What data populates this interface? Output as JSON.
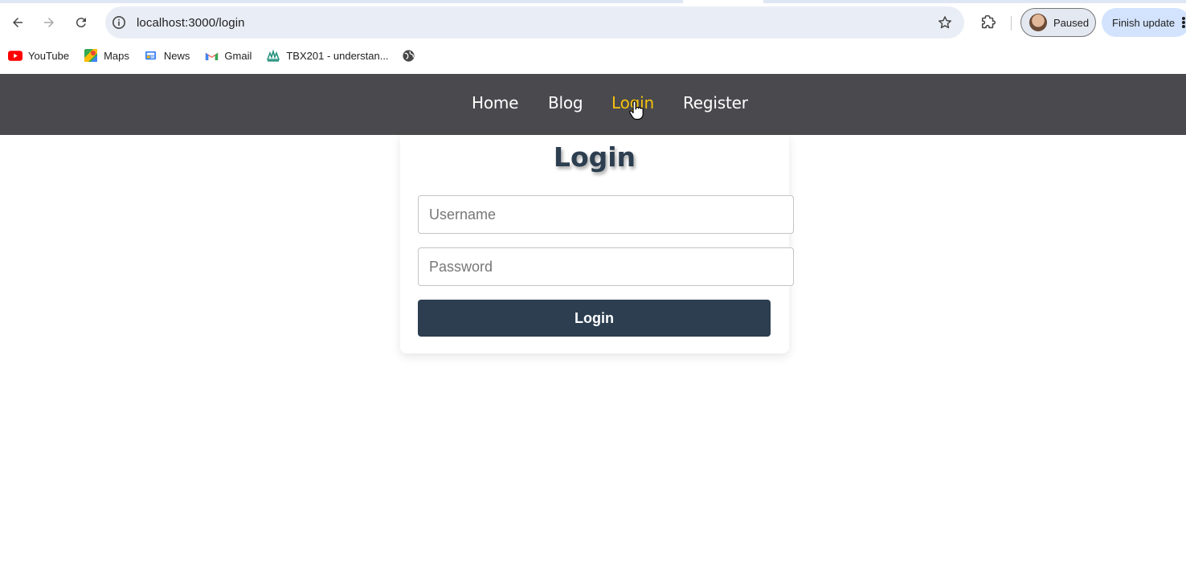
{
  "browser": {
    "url": "localhost:3000/login",
    "profile_label": "Paused",
    "update_label": "Finish update"
  },
  "bookmarks": [
    {
      "label": "YouTube",
      "icon": "youtube-icon"
    },
    {
      "label": "Maps",
      "icon": "maps-icon"
    },
    {
      "label": "News",
      "icon": "news-icon"
    },
    {
      "label": "Gmail",
      "icon": "gmail-icon"
    },
    {
      "label": "TBX201 - understan...",
      "icon": "tbx-icon"
    },
    {
      "label": "",
      "icon": "globe-icon"
    }
  ],
  "site_nav": {
    "items": [
      {
        "label": "Home"
      },
      {
        "label": "Blog"
      },
      {
        "label": "Login",
        "active": true
      },
      {
        "label": "Register"
      }
    ],
    "active_color": "#f4c20d",
    "background": "#4a494d"
  },
  "login_form": {
    "title": "Login",
    "username_placeholder": "Username",
    "password_placeholder": "Password",
    "submit_label": "Login",
    "button_color": "#2c3e50"
  }
}
